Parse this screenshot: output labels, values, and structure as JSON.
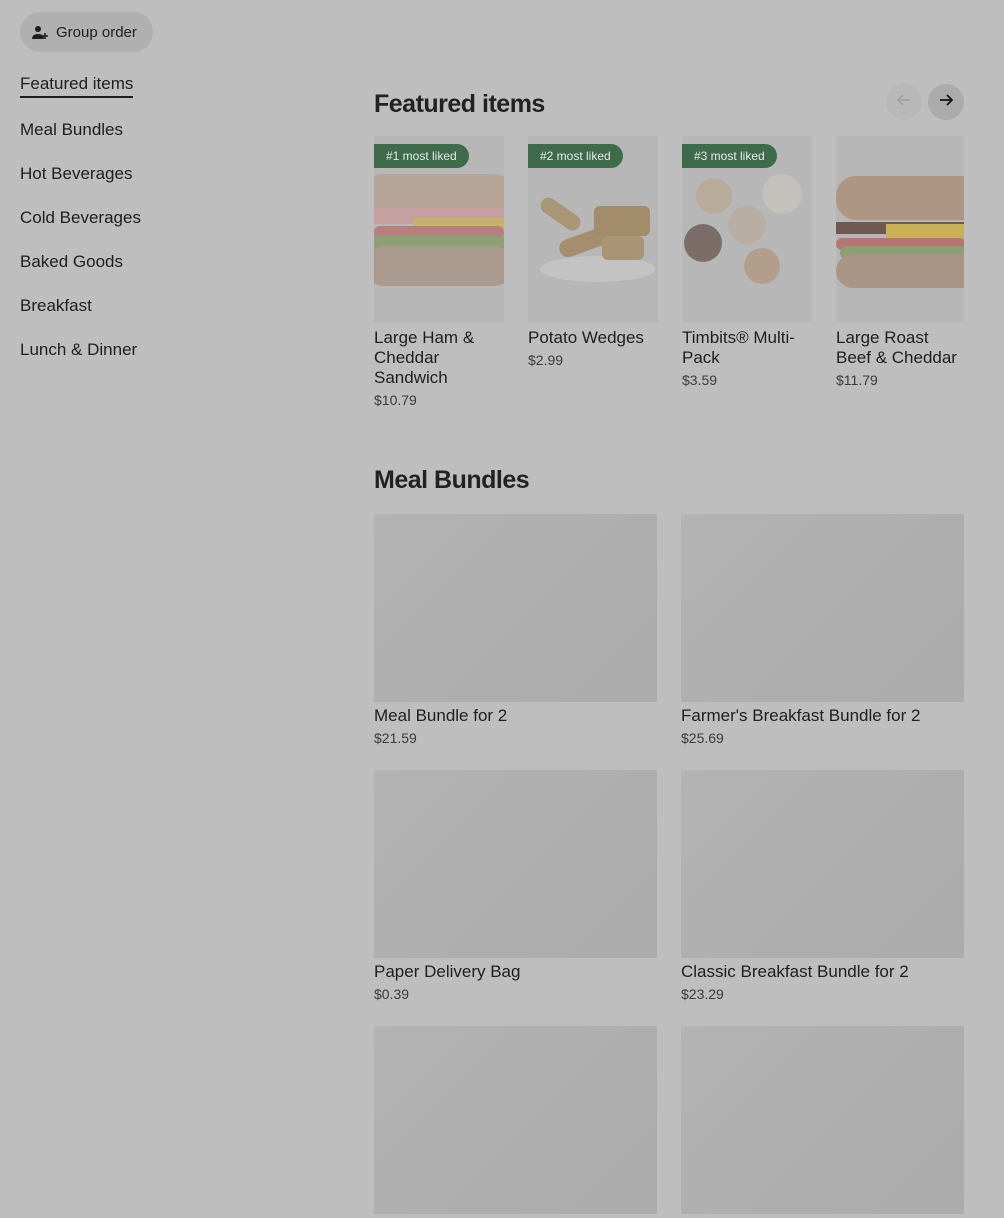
{
  "group_order": {
    "label": "Group order",
    "icon": "add-person-icon"
  },
  "sidebar": {
    "items": [
      {
        "label": "Featured items",
        "active": true
      },
      {
        "label": "Meal Bundles"
      },
      {
        "label": "Hot Beverages"
      },
      {
        "label": "Cold Beverages"
      },
      {
        "label": "Baked Goods"
      },
      {
        "label": "Breakfast"
      },
      {
        "label": "Lunch & Dinner"
      }
    ]
  },
  "featured": {
    "title": "Featured items",
    "prev_icon": "arrow-left-icon",
    "next_icon": "arrow-right-icon",
    "items": [
      {
        "badge": "#1 most liked",
        "name": "Large Ham & Cheddar Sandwich",
        "price": "$10.79"
      },
      {
        "badge": "#2 most liked",
        "name": "Potato Wedges",
        "price": "$2.99"
      },
      {
        "badge": "#3 most liked",
        "name": "Timbits® Multi-Pack",
        "price": "$3.59"
      },
      {
        "badge": "",
        "name": "Large Roast Beef & Cheddar",
        "price": "$11.79"
      }
    ]
  },
  "meal_bundles": {
    "title": "Meal Bundles",
    "items": [
      {
        "name": "Meal Bundle for 2",
        "price": "$21.59"
      },
      {
        "name": "Farmer's Breakfast Bundle for 2",
        "price": "$25.69"
      },
      {
        "name": "Paper Delivery Bag",
        "price": "$0.39"
      },
      {
        "name": "Classic Breakfast Bundle for 2",
        "price": "$23.29"
      },
      {
        "name": "",
        "price": ""
      },
      {
        "name": "",
        "price": ""
      }
    ]
  },
  "colors": {
    "overlay_bg": "#bebebe",
    "badge_bg": "#3e6b4a",
    "text": "#1e1e1e"
  }
}
